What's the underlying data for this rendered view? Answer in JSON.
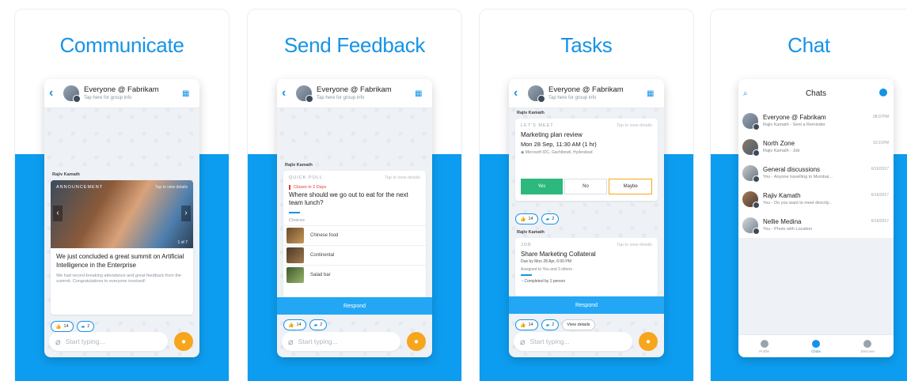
{
  "colors": {
    "brand_blue": "#1593e6",
    "band_blue": "#0d9df0",
    "mic_orange": "#f7a51c",
    "yes_green": "#2db87d"
  },
  "group": {
    "title": "Everyone @ Fabrikam",
    "subtitle": "Tap here for group info"
  },
  "composer": {
    "placeholder": "Start typing..."
  },
  "panels": [
    {
      "headline": "Communicate",
      "sender": "Rajiv Kamath",
      "card": {
        "kicker": "ANNOUNCEMENT",
        "tap": "Tap to view details",
        "counter": "1 of 7",
        "title": "We just concluded a great summit on Artificial Intelligence in the Enterprise",
        "body": "We had record-breaking attendance and great feedback from the summit. Congratulations to everyone involved!"
      },
      "reactions": {
        "likes": "14",
        "comments": "2"
      }
    },
    {
      "headline": "Send Feedback",
      "sender": "Rajiv Kamath",
      "card": {
        "kicker": "QUICK POLL",
        "tap": "Tap to view details",
        "closes": "Closes in 2 Days",
        "question": "Where should we go out to eat for the next team lunch?",
        "choices_label": "Choices",
        "choices": [
          "Chinese food",
          "Continental",
          "Salad bar"
        ],
        "respond": "Respond"
      },
      "reactions": {
        "likes": "14",
        "comments": "2"
      }
    },
    {
      "headline": "Tasks",
      "sender": "Rajiv Kamath",
      "meet": {
        "kicker": "LET'S MEET",
        "tap": "Tap to view details",
        "title": "Marketing plan review",
        "when": "Mon 28 Sep, 11:30 AM (1 hr)",
        "where": "Microsoft IDC, Gachibowli, Hyderabad",
        "yes": "Yes",
        "no": "No",
        "maybe": "Maybe"
      },
      "reactions": {
        "likes": "14",
        "comments": "2"
      },
      "sender2": "Rajiv Kamath",
      "job": {
        "kicker": "JOB",
        "tap": "Tap to view details",
        "title": "Share Marketing Collateral",
        "due": "Due by Mon 28 Apr, 6:00 PM",
        "assigned": "Assigned to You and 3 others",
        "completed": "Completed by 1 person",
        "respond": "Respond"
      },
      "reactions2": {
        "likes": "14",
        "comments": "2",
        "view": "View details"
      }
    },
    {
      "headline": "Chat",
      "header_title": "Chats",
      "chats": [
        {
          "name": "Everyone @ Fabrikam",
          "preview": "Rajiv Kamath - Sent a Reminder",
          "time": "08:07PM"
        },
        {
          "name": "North Zone",
          "preview": "Rajiv Kamath - Job",
          "time": "10:31PM"
        },
        {
          "name": "General discussions",
          "preview": "You - Anyone travelling to Mumbai...",
          "time": "6/16/2017"
        },
        {
          "name": "Rajiv Kamath",
          "preview": "You - Do you want to meet directly...",
          "time": "6/16/2017"
        },
        {
          "name": "Nellie Medina",
          "preview": "You - Photo with Location",
          "time": "6/16/2017"
        }
      ],
      "tabs": [
        "Profile",
        "Chats",
        "Discover"
      ]
    }
  ]
}
